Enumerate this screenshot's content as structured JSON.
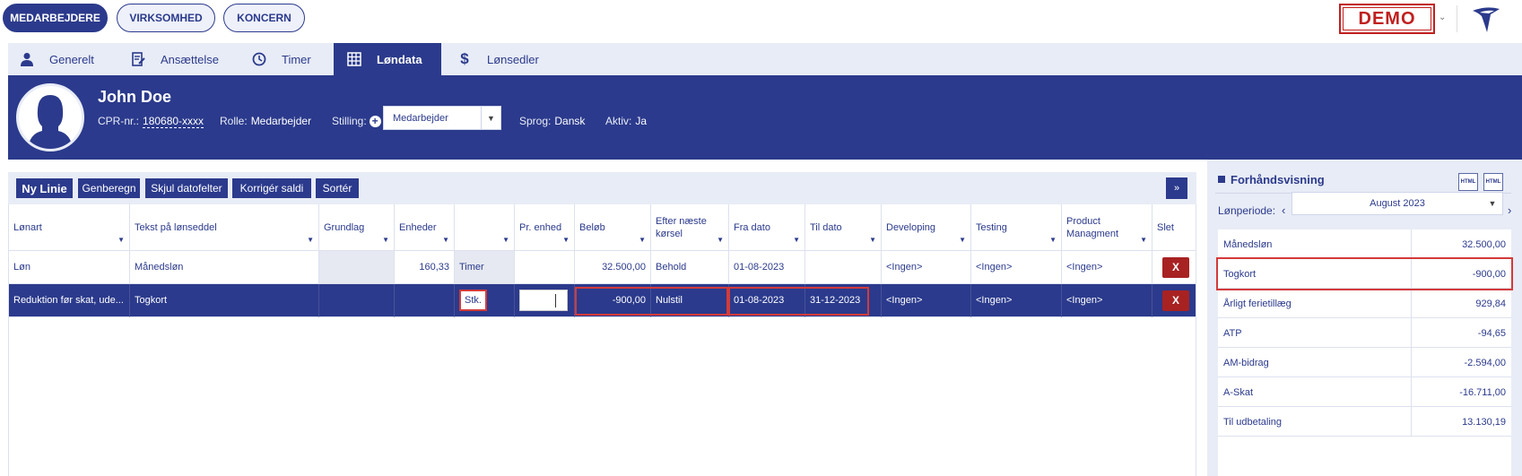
{
  "top_nav": {
    "buttons": [
      "MEDARBEJDERE",
      "VIRKSOMHED",
      "KONCERN"
    ],
    "demo_label": "DEMO",
    "demo_chevron": "⌄"
  },
  "tabs": [
    {
      "label": "Generelt",
      "icon": "person-icon"
    },
    {
      "label": "Ansættelse",
      "icon": "contract-icon"
    },
    {
      "label": "Timer",
      "icon": "clock-icon"
    },
    {
      "label": "Løndata",
      "icon": "table-icon",
      "active": true
    },
    {
      "label": "Lønsedler",
      "icon": "dollar-icon"
    }
  ],
  "employee": {
    "name": "John Doe",
    "cpr_label": "CPR-nr.:",
    "cpr_value": "180680-xxxx",
    "role_label": "Rolle:",
    "role_value": "Medarbejder",
    "position_label": "Stilling:",
    "position_value": "Medarbejder",
    "language_label": "Sprog:",
    "language_value": "Dansk",
    "active_label": "Aktiv:",
    "active_value": "Ja"
  },
  "toolbar": {
    "new_line": "Ny Linie",
    "recalc": "Genberegn",
    "hide_dates": "Skjul datofelter",
    "correct_balance": "Korrigér saldi",
    "sort": "Sortér",
    "expand": "»"
  },
  "table": {
    "columns": [
      "Lønart",
      "Tekst på lønseddel",
      "Grundlag",
      "Enheder",
      "",
      "Pr. enhed",
      "Beløb",
      "Efter næste kørsel",
      "Fra dato",
      "Til dato",
      "Developing",
      "Testing",
      "Product Managment",
      "Slet"
    ],
    "rows": [
      {
        "lonart": "Løn",
        "tekst": "Månedsløn",
        "grundlag": "",
        "enheder": "160,33",
        "enhed_type": "Timer",
        "pr_enhed": "",
        "belob": "32.500,00",
        "efter": "Behold",
        "fra": "01-08-2023",
        "til": "",
        "developing": "<Ingen>",
        "testing": "<Ingen>",
        "product": "<Ingen>",
        "slet": "X"
      },
      {
        "lonart": "Reduktion før skat, ude...",
        "tekst": "Togkort",
        "grundlag": "",
        "enheder": "",
        "enhed_type": "Stk.",
        "pr_enhed": "",
        "belob": "-900,00",
        "efter": "Nulstil",
        "fra": "01-08-2023",
        "til": "31-12-2023",
        "developing": "<Ingen>",
        "testing": "<Ingen>",
        "product": "<Ingen>",
        "slet": "X"
      }
    ]
  },
  "preview": {
    "title": "Forhåndsvisning",
    "html_icon_label": "HTML",
    "period_label": "Lønperiode:",
    "period_value": "August 2023",
    "rows": [
      {
        "label": "Månedsløn",
        "value": "32.500,00"
      },
      {
        "label": "Togkort",
        "value": "-900,00"
      },
      {
        "label": "Årligt ferietillæg",
        "value": "929,84"
      },
      {
        "label": "ATP",
        "value": "-94,65"
      },
      {
        "label": "AM-bidrag",
        "value": "-2.594,00"
      },
      {
        "label": "A-Skat",
        "value": "-16.711,00"
      },
      {
        "label": "Til udbetaling",
        "value": "13.130,19"
      }
    ]
  },
  "colors": {
    "primary": "#2b3a8c",
    "light": "#e8ecf6",
    "delete": "#a82222",
    "highlight": "#d33a3a"
  }
}
